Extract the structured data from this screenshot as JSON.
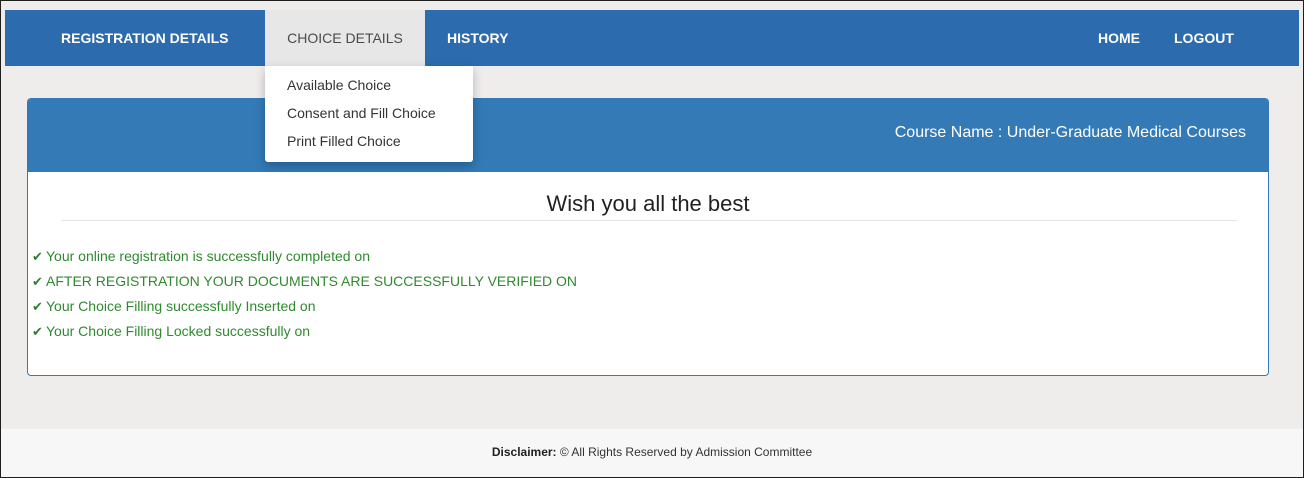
{
  "nav": {
    "registration_details": "REGISTRATION DETAILS",
    "choice_details": "CHOICE DETAILS",
    "history": "HISTORY",
    "home": "HOME",
    "logout": "LOGOUT"
  },
  "dropdown": {
    "items": [
      "Available Choice",
      "Consent and Fill Choice",
      "Print Filled Choice"
    ]
  },
  "panel": {
    "course_name": "Course Name : Under-Graduate Medical Courses",
    "wish": "Wish you all the best",
    "statuses": [
      "Your online registration is successfully completed on",
      "AFTER REGISTRATION YOUR DOCUMENTS ARE SUCCESSFULLY VERIFIED ON",
      "Your Choice Filling successfully Inserted on",
      "Your Choice Filling Locked successfully on"
    ],
    "check_icon": "check-icon",
    "check_glyph": "✔"
  },
  "footer": {
    "label": "Disclaimer:",
    "text": " © All Rights Reserved by Admission Committee"
  },
  "colors": {
    "navbar": "#2c6bae",
    "panel_heading": "#337ab7",
    "status_text": "#2f8a2f"
  }
}
